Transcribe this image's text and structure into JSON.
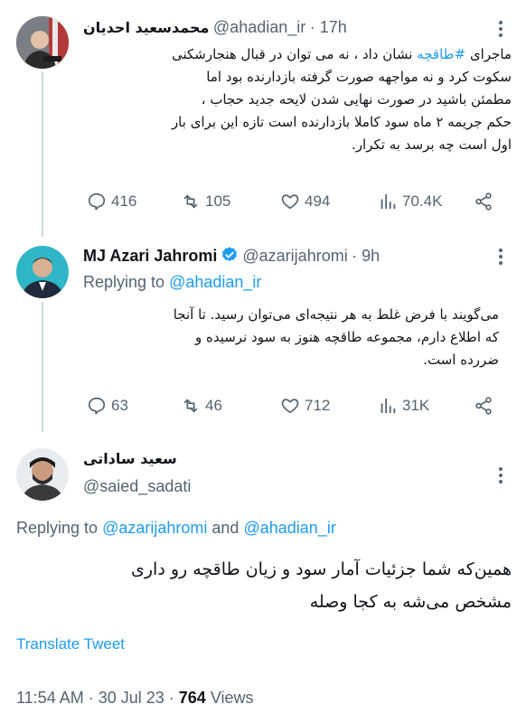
{
  "tweet1": {
    "name": "محمدسعید احدیان",
    "handle": "@ahadian_ir",
    "time": "· 17h",
    "hashtag": "#طاقچه",
    "text_after_hashtag": "نشان داد ، نه می توان در قبال هنجارشکنی",
    "text_lead": "ماجرای",
    "lines": [
      "سکوت کرد و نه مواجهه صورت گرفته بازدارنده بود  اما",
      "مطمئن باشید در صورت نهایی شدن لایحه جدید حجاب ،",
      "حکم جریمه ۲ ماه سود  کاملا بازدارنده است تازه این برای بار",
      "اول است چه برسد به تکرار."
    ],
    "replies": "416",
    "retweets": "105",
    "likes": "494",
    "views": "70.4K"
  },
  "tweet2": {
    "name": "MJ Azari Jahromi",
    "handle": "@azarijahromi",
    "time": "· 9h",
    "replying_prefix": "Replying to",
    "replying_to": "@ahadian_ir",
    "lines": [
      "می‌گویند با فرض غلط به هر نتیجه‌ای می‌توان رسید. تا آنجا",
      "که اطلاع دارم، مجموعه طاقچه هنوز به سود نرسیده و",
      "ضررده است."
    ],
    "replies": "63",
    "retweets": "46",
    "likes": "712",
    "views": "31K"
  },
  "tweet3": {
    "name": "سعید ساداتی",
    "handle": "@saied_sadati",
    "replying_prefix": "Replying to",
    "replying_to_1": "@azarijahromi",
    "replying_and": "and",
    "replying_to_2": "@ahadian_ir",
    "lines": [
      "همین‌که شما جزئیات آمار سود و زیان طاقچه رو داری",
      "مشخص می‌شه به کجا وصله"
    ],
    "translate": "Translate Tweet",
    "time": "11:54 AM · 30 Jul 23 ·",
    "views_count": "764",
    "views_label": "Views"
  },
  "icons": {
    "reply": "reply-icon",
    "retweet": "retweet-icon",
    "like": "heart-icon",
    "views": "views-icon",
    "share": "share-icon",
    "more": "more-icon",
    "verified": "verified-badge-icon"
  },
  "colors": {
    "accent": "#1d9bf0",
    "secondary_text": "#536471",
    "primary_text": "#0f1419"
  }
}
